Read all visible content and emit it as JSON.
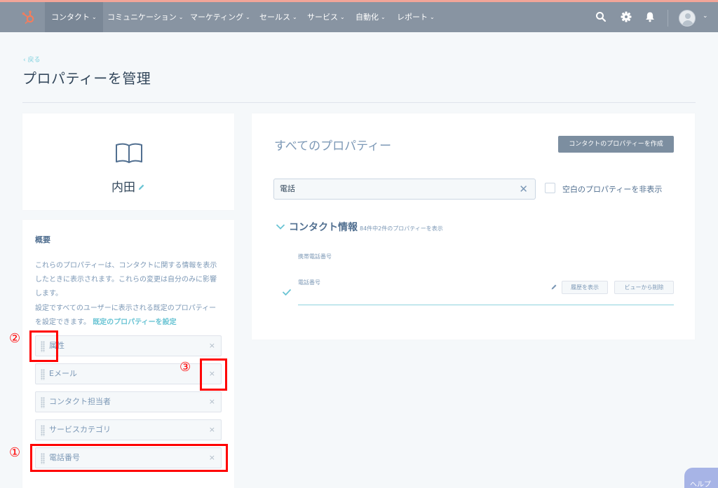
{
  "nav": {
    "items": [
      {
        "label": "コンタクト",
        "active": true
      },
      {
        "label": "コミュニケーション"
      },
      {
        "label": "マーケティング"
      },
      {
        "label": "セールス"
      },
      {
        "label": "サービス"
      },
      {
        "label": "自動化"
      },
      {
        "label": "レポート"
      }
    ],
    "icons": [
      "search-icon",
      "gear-icon",
      "bell-icon",
      "avatar"
    ]
  },
  "header": {
    "back_label": "‹ 戻る",
    "title": "プロパティーを管理"
  },
  "record": {
    "name": "内田"
  },
  "overview": {
    "title": "概要",
    "description": "これらのプロパティーは、コンタクトに関する情報を表示したときに表示されます。これらの変更は自分のみに影響します。",
    "description2": "設定ですべてのユーザーに表示される既定のプロパティーを設定できます。",
    "default_link": "既定のプロパティーを設定",
    "items": [
      {
        "label": "属性"
      },
      {
        "label": "Eメール"
      },
      {
        "label": "コンタクト担当者"
      },
      {
        "label": "サービスカテゴリ"
      },
      {
        "label": "電話番号"
      }
    ],
    "close_glyph": "×"
  },
  "annotations": [
    "①",
    "②",
    "③"
  ],
  "properties": {
    "title": "すべてのプロパティー",
    "create_button": "コンタクトのプロパティーを作成",
    "search_value": "電話",
    "hide_empty_label": "空白のプロパティーを非表示",
    "group": {
      "title": "コンタクト情報",
      "count": "84件中2件のプロパティーを表示",
      "rows": [
        {
          "label": "携帯電話番号"
        },
        {
          "label": "電話番号",
          "selected": true
        }
      ],
      "history_button": "履歴を表示",
      "remove_button": "ビューから削除"
    }
  },
  "help": {
    "label": "ヘルプ"
  },
  "colors": {
    "nav_bg": "#8894a2",
    "accent_stripe": "#f2a598",
    "annotation": "#ff0000",
    "link": "#6ac4d4"
  }
}
